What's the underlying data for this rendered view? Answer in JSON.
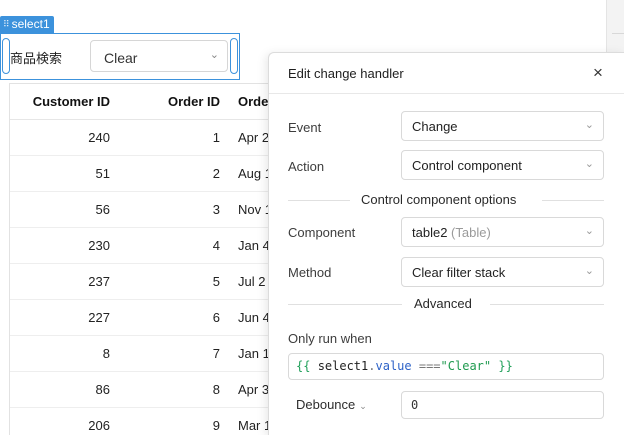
{
  "component": {
    "tag_label": "select1",
    "field_label": "商品検索",
    "select_value": "Clear"
  },
  "table": {
    "columns": [
      "Customer ID",
      "Order ID",
      "Orde"
    ],
    "rows": [
      {
        "customer_id": "240",
        "order_id": "1",
        "order_date": "Apr 2"
      },
      {
        "customer_id": "51",
        "order_id": "2",
        "order_date": "Aug 1"
      },
      {
        "customer_id": "56",
        "order_id": "3",
        "order_date": "Nov 1"
      },
      {
        "customer_id": "230",
        "order_id": "4",
        "order_date": "Jan 4"
      },
      {
        "customer_id": "237",
        "order_id": "5",
        "order_date": "Jul 2"
      },
      {
        "customer_id": "227",
        "order_id": "6",
        "order_date": "Jun 4"
      },
      {
        "customer_id": "8",
        "order_id": "7",
        "order_date": "Jan 1"
      },
      {
        "customer_id": "86",
        "order_id": "8",
        "order_date": "Apr 3"
      },
      {
        "customer_id": "206",
        "order_id": "9",
        "order_date": "Mar 1"
      }
    ]
  },
  "modal": {
    "title": "Edit change handler",
    "close_glyph": "×",
    "event": {
      "label": "Event",
      "value": "Change"
    },
    "action": {
      "label": "Action",
      "value": "Control component"
    },
    "options_section": "Control component options",
    "component": {
      "label": "Component",
      "value": "table2",
      "value_hint": "(Table)"
    },
    "method": {
      "label": "Method",
      "value": "Clear filter stack"
    },
    "advanced_section": "Advanced",
    "only_run_when": {
      "label": "Only run when",
      "code_open": "{{",
      "code_ident": "select1",
      "code_dot": ".",
      "code_prop": "value",
      "code_op": "===",
      "code_string": "\"Clear\"",
      "code_close": "}}"
    },
    "debounce": {
      "label": "Debounce",
      "value": "0"
    }
  },
  "icons": {
    "chevron": "⌄",
    "grip": "⠿"
  },
  "colors": {
    "selection_blue": "#3c92dc",
    "code_green": "#21a05a",
    "code_blue": "#2d62c7"
  }
}
